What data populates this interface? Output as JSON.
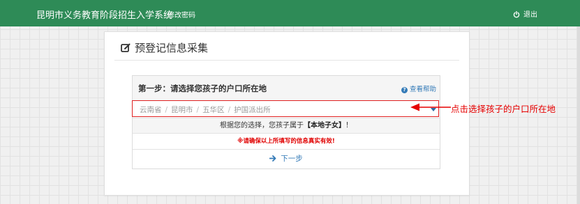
{
  "app": {
    "title": "昆明市义务教育阶段招生入学系统",
    "change_password": "修改密码",
    "logout": "退出"
  },
  "card": {
    "title": "预登记信息采集"
  },
  "step": {
    "title": "第一步：请选择您孩子的户口所在地",
    "help": "查看帮助"
  },
  "region": {
    "path": [
      "云南省",
      "昆明市",
      "五华区",
      "护国派出所"
    ]
  },
  "result": {
    "prefix": "根据您的选择，您孩子属于",
    "category": "【本地子女】",
    "suffix": "！"
  },
  "warning": "※请确保以上所填写的信息真实有效!",
  "next_label": "下一步",
  "annotation": "点击选择孩子的户口所在地",
  "colors": {
    "navbar": "#2e8b57",
    "link": "#337ab7",
    "warning": "#e00000",
    "highlight": "#e02020"
  }
}
